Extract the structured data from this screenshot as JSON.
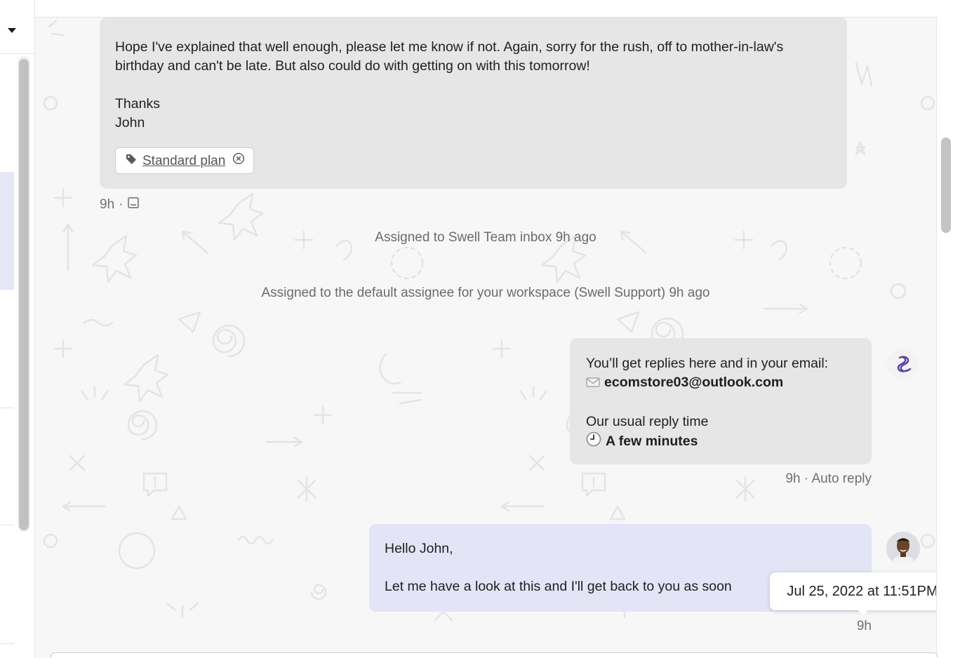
{
  "conversation": {
    "messages": [
      {
        "author": "customer",
        "lines": [
          "Hope I've explained that well enough, please let me know if not. Again, sorry for the rush, off to mother-in-law's birthday and can't be late. But also could do with getting on with this tomorrow!",
          "",
          "Thanks",
          "John"
        ],
        "tag": {
          "label": "Standard plan",
          "icon": "tag-icon",
          "remove_icon": "remove-tag-icon"
        },
        "meta": {
          "time": "9h",
          "separator": "·",
          "icon": "note-icon"
        }
      },
      {
        "author": "bot",
        "line1": "You’ll get replies here and in your email:",
        "email_icon": "envelope-icon",
        "email": "ecomstore03@outlook.com",
        "line3": "Our usual reply time",
        "reply_icon": "clock-icon",
        "reply_time": "A few minutes",
        "meta": "9h · Auto reply",
        "avatar": "swell-logo-icon"
      },
      {
        "author": "agent",
        "greeting": "Hello John,",
        "body": "Let me have a look at this and I'll get back to you as soon",
        "meta": "9h",
        "avatar": "agent-avatar"
      }
    ],
    "events": [
      "Assigned to Swell Team inbox 9h ago",
      "Assigned to the default assignee for your workspace (Swell Support) 9h ago"
    ],
    "tooltip": "Jul 25, 2022 at 11:51PM"
  },
  "colors": {
    "customer_bubble": "#e6e6e6",
    "agent_bubble": "#e3e4f6",
    "brand_purple": "#5b3ea6",
    "background": "#f7f7f8"
  }
}
